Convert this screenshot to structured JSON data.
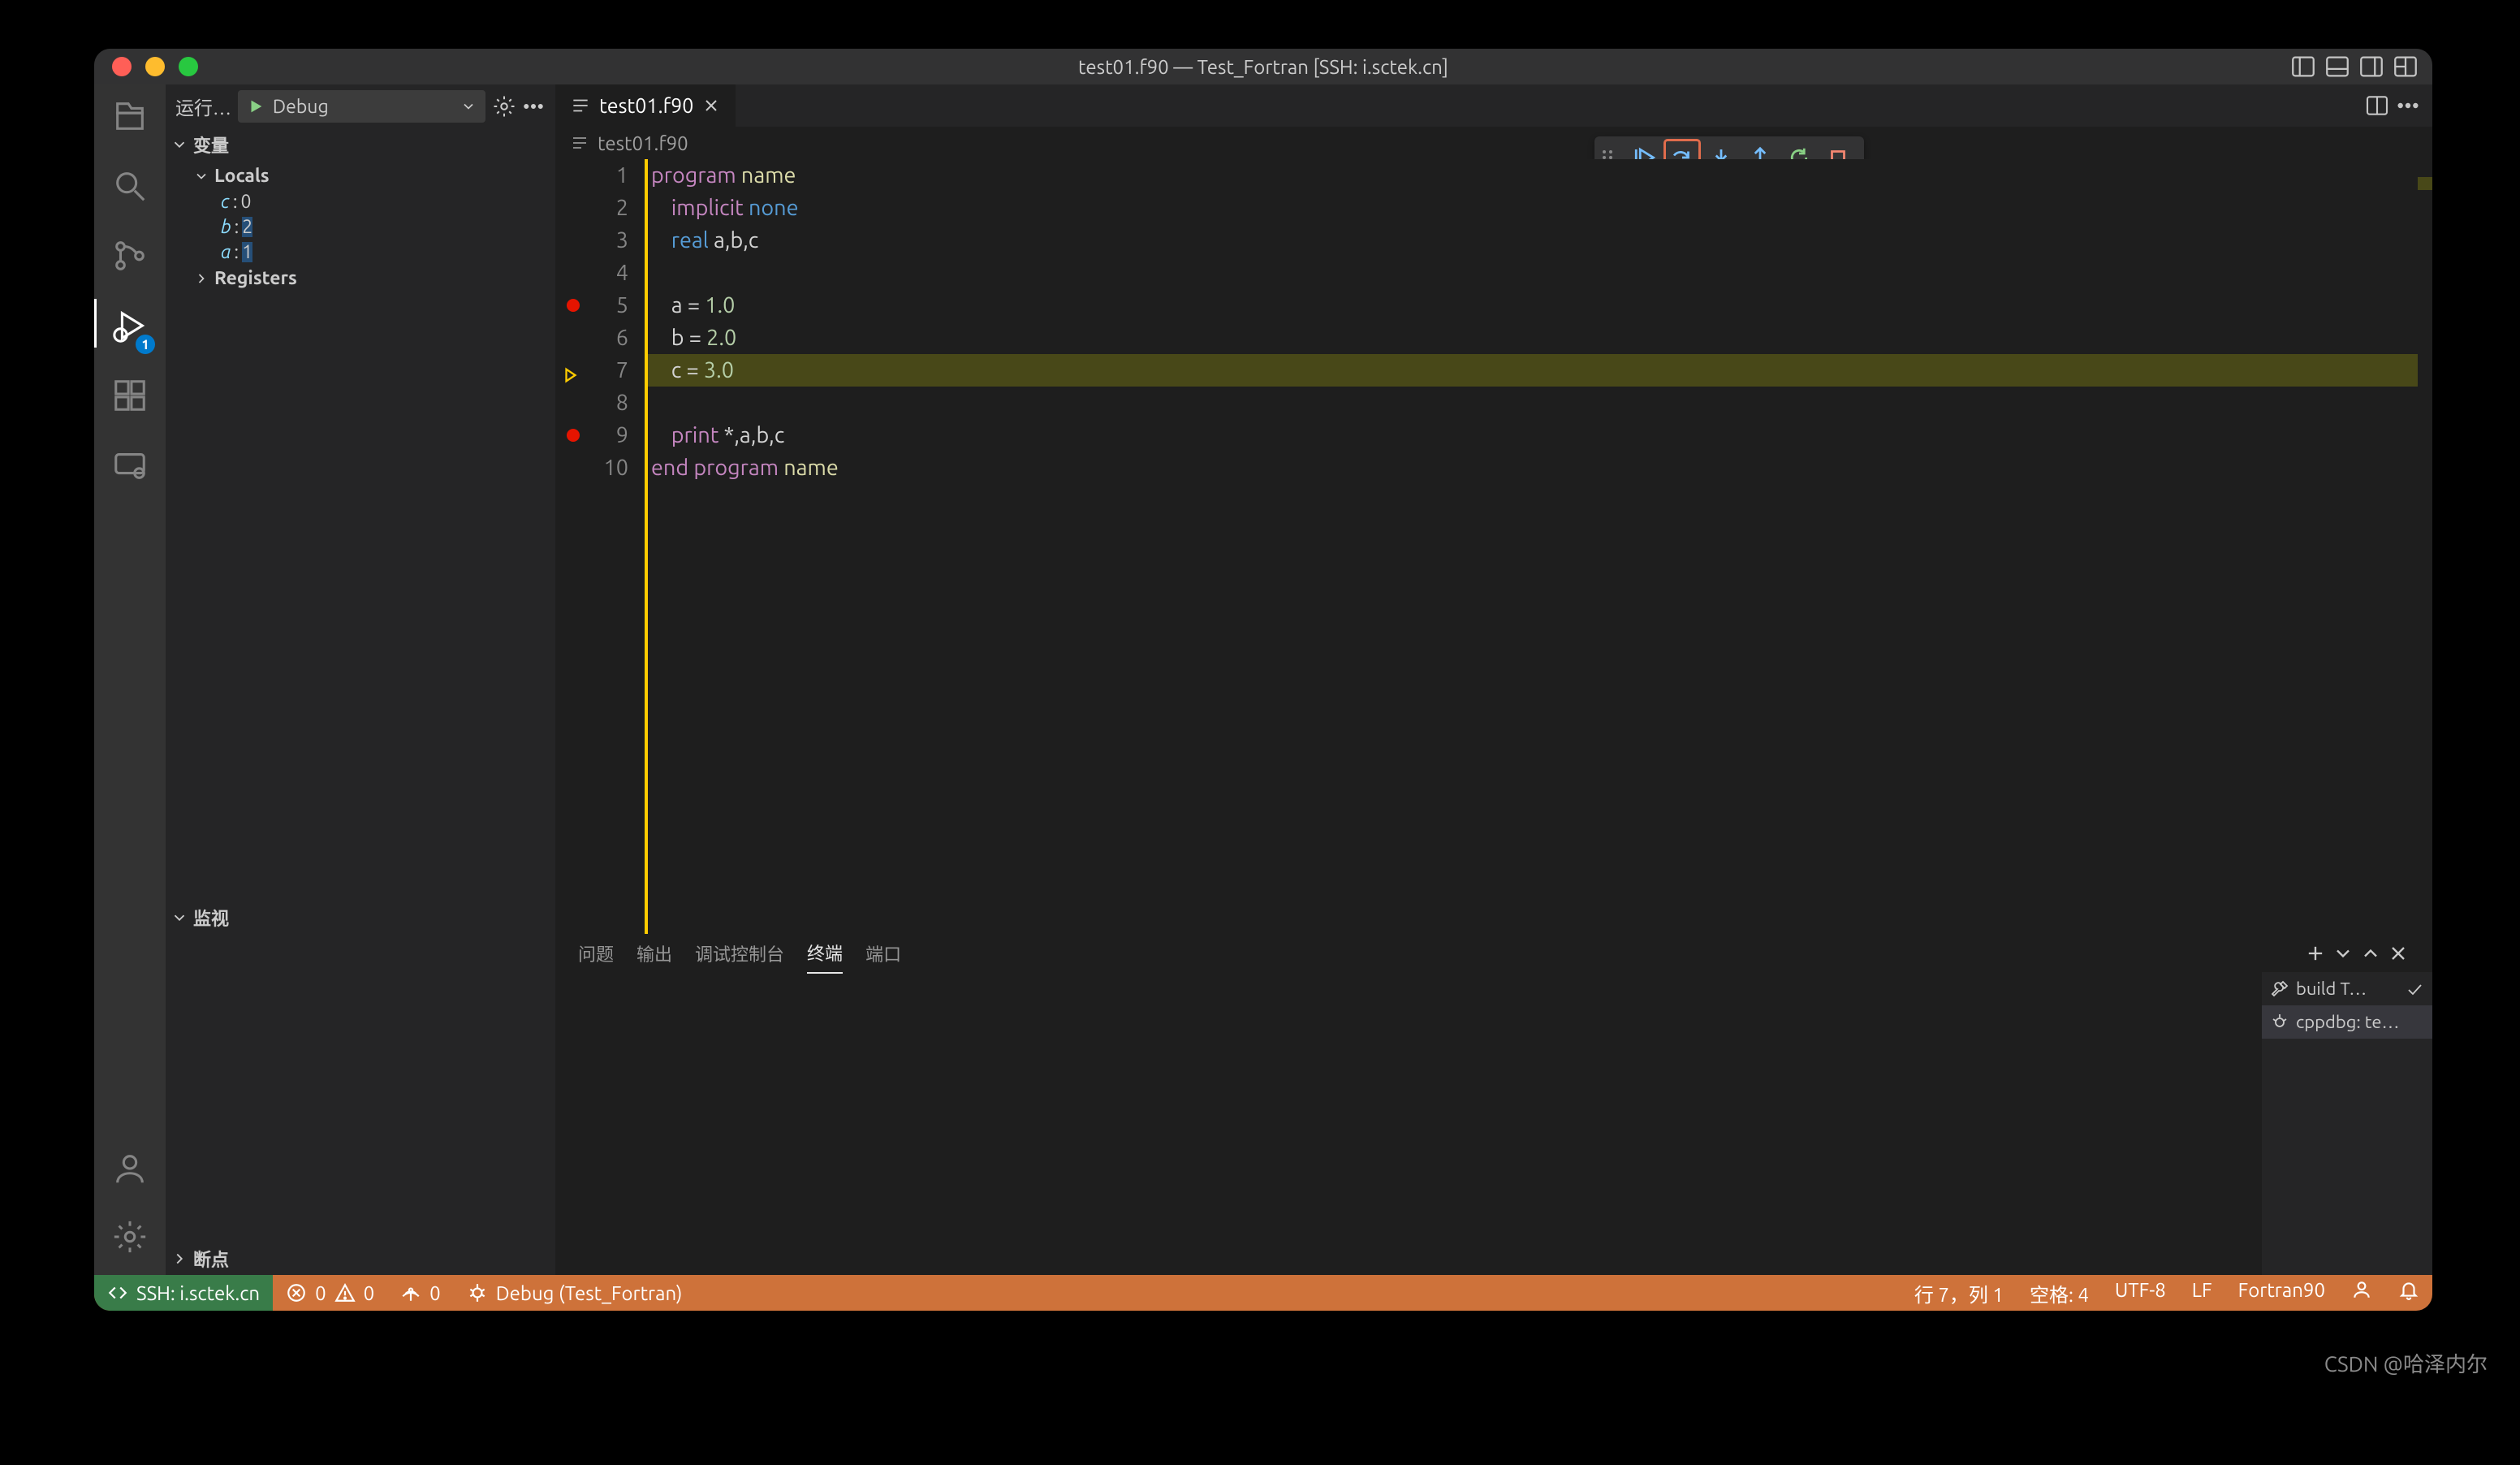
{
  "window": {
    "title": "test01.f90 — Test_Fortran [SSH: i.sctek.cn]"
  },
  "activity": {
    "debug_badge": "1"
  },
  "run": {
    "label": "运行…",
    "config": "Debug"
  },
  "variables": {
    "title": "变量",
    "locals": {
      "label": "Locals",
      "items": [
        {
          "name": "c",
          "value": "0"
        },
        {
          "name": "b",
          "value": "2"
        },
        {
          "name": "a",
          "value": "1"
        }
      ]
    },
    "registers": {
      "label": "Registers"
    }
  },
  "watch": {
    "title": "监视"
  },
  "breakpoints": {
    "title": "断点"
  },
  "tab": {
    "filename": "test01.f90"
  },
  "breadcrumb": {
    "filename": "test01.f90"
  },
  "code": {
    "lines": [
      {
        "n": 1,
        "html": "<span class='kw'>program</span> <span class='fn'>name</span>"
      },
      {
        "n": 2,
        "html": "    <span class='kw'>implicit</span> <span class='ty'>none</span>"
      },
      {
        "n": 3,
        "html": "    <span class='ty'>real</span> <span class='id'>a,b,c</span>"
      },
      {
        "n": 4,
        "html": ""
      },
      {
        "n": 5,
        "html": "    <span class='id'>a</span> <span class='op'>=</span> <span class='num'>1.0</span>",
        "bp": true
      },
      {
        "n": 6,
        "html": "    <span class='id'>b</span> <span class='op'>=</span> <span class='num'>2.0</span>"
      },
      {
        "n": 7,
        "html": "    <span class='id'>c</span> <span class='op'>=</span> <span class='num'>3.0</span>",
        "exec": true
      },
      {
        "n": 8,
        "html": ""
      },
      {
        "n": 9,
        "html": "    <span class='kw'>print</span> <span class='op'>*</span><span class='id'>,a,b,c</span>",
        "bp": true
      },
      {
        "n": 10,
        "html": "<span class='kw'>end</span> <span class='kw'>program</span> <span class='fn'>name</span>"
      }
    ]
  },
  "panel": {
    "tabs": {
      "problems": "问题",
      "output": "输出",
      "debug": "调试控制台",
      "terminal": "终端",
      "ports": "端口"
    },
    "terminals": [
      {
        "name": "build T…",
        "icon": "tools",
        "check": true
      },
      {
        "name": "cppdbg: te…",
        "icon": "bug"
      }
    ]
  },
  "status": {
    "remote": "SSH: i.sctek.cn",
    "err": "0",
    "warn": "0",
    "ports": "0",
    "debug": "Debug (Test_Fortran)",
    "pos": "行 7，列 1",
    "spaces": "空格: 4",
    "enc": "UTF-8",
    "eol": "LF",
    "lang": "Fortran90"
  },
  "watermark": "CSDN @哈泽内尔"
}
